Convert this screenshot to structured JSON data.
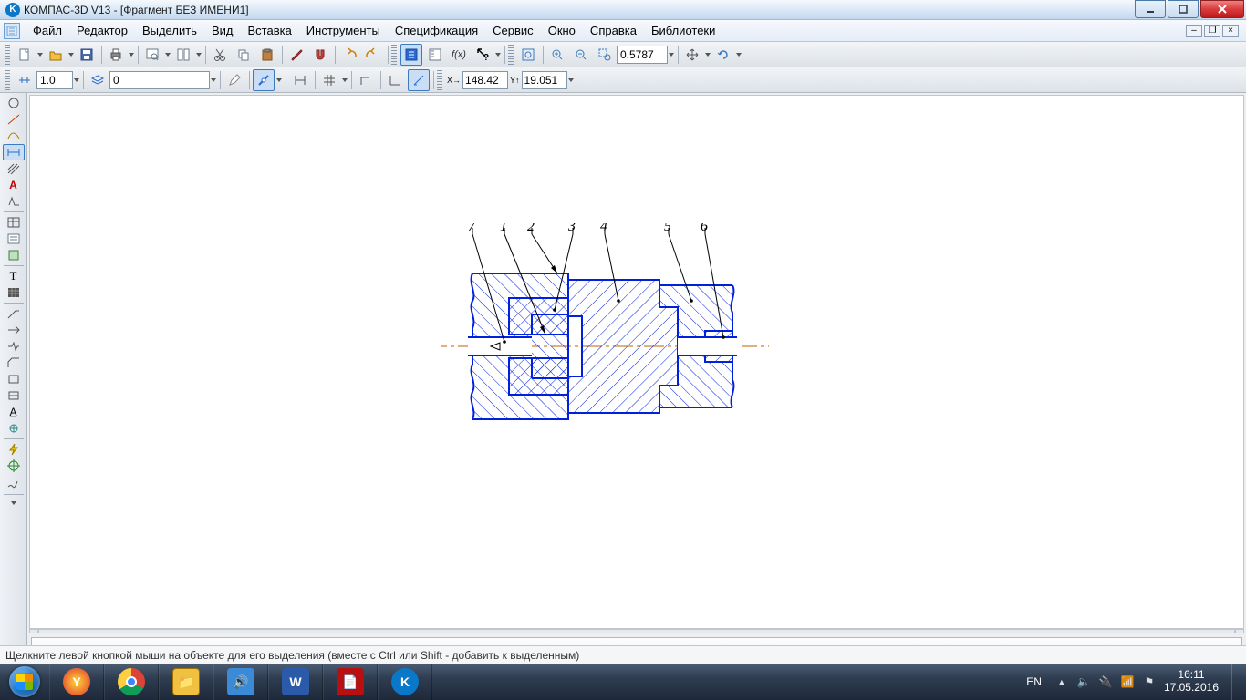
{
  "title_bar": {
    "app_name": "КОМПАС-3D V13",
    "doc_title": "[Фрагмент БЕЗ ИМЕНИ1]"
  },
  "menu": {
    "file": "Файл",
    "editor": "Редактор",
    "select": "Выделить",
    "view": "Вид",
    "insert": "Вставка",
    "tools": "Инструменты",
    "spec": "Спецификация",
    "service": "Сервис",
    "window": "Окно",
    "help": "Справка",
    "libraries": "Библиотеки"
  },
  "toolbar1": {
    "zoom_value": "0.5787"
  },
  "toolbar2": {
    "step_value": "1.0",
    "layer_value": "0",
    "coord_x": "148.42",
    "coord_y": "19.051"
  },
  "status": {
    "text": "Щелкните левой кнопкой мыши на объекте для его выделения (вместе с Ctrl или Shift - добавить к выделенным)"
  },
  "taskbar": {
    "lang": "EN",
    "time": "16:11",
    "date": "17.05.2016"
  },
  "drawing": {
    "callouts": [
      "1",
      "2",
      "3",
      "4",
      "5",
      "6",
      "7"
    ]
  }
}
